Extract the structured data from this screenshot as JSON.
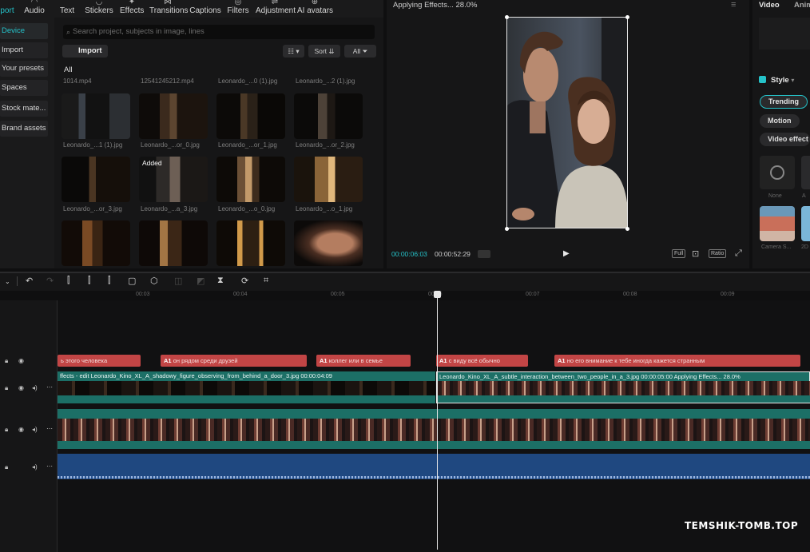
{
  "toolbar": {
    "items": [
      {
        "label": "Import",
        "visible": "port",
        "icon": "import-icon",
        "active": true
      },
      {
        "label": "Audio",
        "icon": "audio-icon"
      },
      {
        "label": "Text",
        "icon": "text-icon"
      },
      {
        "label": "Stickers",
        "icon": "sticker-icon"
      },
      {
        "label": "Effects",
        "icon": "effects-icon"
      },
      {
        "label": "Transitions",
        "icon": "transitions-icon"
      },
      {
        "label": "Captions",
        "icon": "captions-icon"
      },
      {
        "label": "Filters",
        "icon": "filters-icon"
      },
      {
        "label": "Adjustment",
        "icon": "adjustment-icon"
      },
      {
        "label": "AI avatars",
        "icon": "ai-avatar-icon"
      }
    ]
  },
  "sidebar": {
    "items": [
      {
        "label": "Device",
        "active": true
      },
      {
        "label": "Import"
      },
      {
        "label": "Your presets"
      },
      {
        "label": "Spaces"
      },
      {
        "label": "Stock mate..."
      },
      {
        "label": "Brand assets"
      }
    ]
  },
  "media": {
    "search_placeholder": "Search project, subjects in image, lines",
    "import_label": "Import",
    "view_label": "☷",
    "sort_label": "Sort",
    "all_filter_label": "All",
    "all_label": "All",
    "top_labels": [
      "1014.mp4",
      "12541245212.mp4",
      "Leonardo_...0 (1).jpg",
      "Leonardo_...2 (1).jpg"
    ],
    "thumbs": [
      {
        "label": "Leonardo_...1 (1).jpg"
      },
      {
        "label": "Leonardo_...or_0.jpg"
      },
      {
        "label": "Leonardo_...or_1.jpg"
      },
      {
        "label": "Leonardo_...or_2.jpg"
      },
      {
        "label": "Leonardo_...or_3.jpg"
      },
      {
        "label": "Leonardo_...a_3.jpg",
        "badge": "Added"
      },
      {
        "label": "Leonardo_...o_0.jpg"
      },
      {
        "label": "Leonardo_...o_1.jpg"
      },
      {
        "label": ""
      },
      {
        "label": ""
      },
      {
        "label": ""
      },
      {
        "label": ""
      }
    ]
  },
  "player": {
    "title": "Applying Effects... 28.0%",
    "time_current": "00:00:06:03",
    "time_total": "00:00:52:29",
    "btn_full": "Full",
    "btn_ratio": "Ratio"
  },
  "right_panel": {
    "tab_video": "Video",
    "tab_animation": "Anim",
    "style_label": "Style",
    "pills": [
      "Trending",
      "Motion",
      "Video effect"
    ],
    "preset_none": "None",
    "preset_a": "A",
    "preset_camera": "Camera S...",
    "preset_2": "2D"
  },
  "timeline": {
    "ruler": [
      "00:03",
      "00:04",
      "00:05",
      "00:06",
      "00:07",
      "00:08",
      "00:09"
    ],
    "text_clips": [
      {
        "prefix": "",
        "text": "ь этого человека"
      },
      {
        "prefix": "A1",
        "text": "он рядом среди друзей"
      },
      {
        "prefix": "A1",
        "text": "коллег или в семье"
      },
      {
        "prefix": "A1",
        "text": "с виду всё обычно"
      },
      {
        "prefix": "A1",
        "text": "но его внимание к тебе иногда кажется странным"
      }
    ],
    "video_clips": [
      {
        "text": "ffects - edit   Leonardo_Kino_XL_A_shadowy_figure_observing_from_behind_a_door_3.jpg   00:00:04:09"
      },
      {
        "text": "Leonardo_Kino_XL_A_subtle_interaction_between_two_people_in_a_3.jpg   00:00:05:00   Applying Effects... 28.0%"
      }
    ]
  },
  "watermark": "TEMSHIK-TOMB.TOP",
  "colors": {
    "accent": "#25c2c9",
    "text_clip": "#c24545",
    "video_clip": "#1c6f66",
    "audio": "#1f4880"
  }
}
